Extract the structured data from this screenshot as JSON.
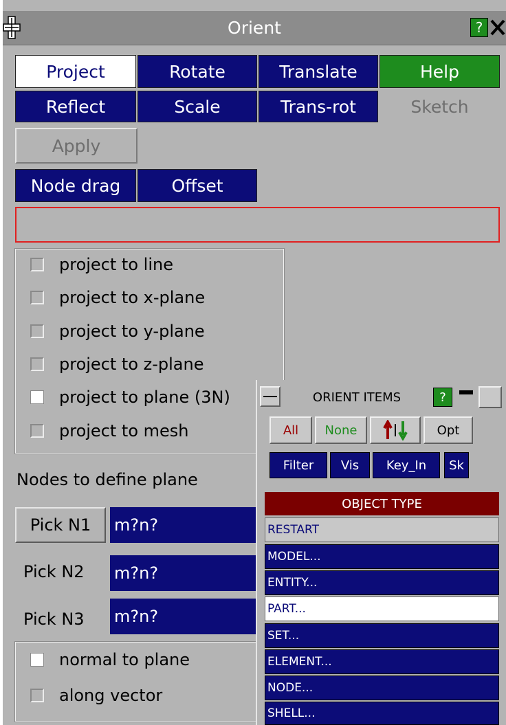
{
  "window": {
    "title": "Orient",
    "help_glyph": "?",
    "close_glyph": "✕"
  },
  "mode_buttons": {
    "project": "Project",
    "rotate": "Rotate",
    "translate": "Translate",
    "help": "Help",
    "reflect": "Reflect",
    "scale": "Scale",
    "trans_rot": "Trans-rot",
    "sketch": "Sketch"
  },
  "apply": "Apply",
  "node_drag": "Node drag",
  "offset": "Offset",
  "project_options": [
    {
      "label": "project to line",
      "checked": false
    },
    {
      "label": "project to x-plane",
      "checked": false
    },
    {
      "label": "project to y-plane",
      "checked": false
    },
    {
      "label": "project to z-plane",
      "checked": false
    },
    {
      "label": "project to plane (3N)",
      "checked": true
    },
    {
      "label": "project to mesh",
      "checked": false
    }
  ],
  "nodes_heading": "Nodes to define plane",
  "picks": [
    {
      "label": "Pick N1",
      "value": "m?n?"
    },
    {
      "label": "Pick N2",
      "value": "m?n?"
    },
    {
      "label": "Pick N3",
      "value": "m?n?"
    }
  ],
  "direction_options": [
    {
      "label": "normal to plane",
      "checked": true
    },
    {
      "label": "along vector",
      "checked": false
    }
  ],
  "orient_items": {
    "title": "ORIENT ITEMS",
    "help_glyph": "?",
    "all": "All",
    "none": "None",
    "opt": "Opt",
    "filter": "Filter",
    "vis": "Vis",
    "key_in": "Key_In",
    "sk": "Sk",
    "object_type_header": "OBJECT TYPE",
    "items": [
      "RESTART",
      "MODEL...",
      "ENTITY...",
      "PART...",
      "SET...",
      "ELEMENT...",
      "NODE...",
      "SHELL..."
    ]
  },
  "colors": {
    "panel_bg": "#b4b4b4",
    "button_navy": "#0c0c78",
    "help_green": "#1e8c1e",
    "error_border": "#e02020",
    "object_header": "#7a0000"
  }
}
